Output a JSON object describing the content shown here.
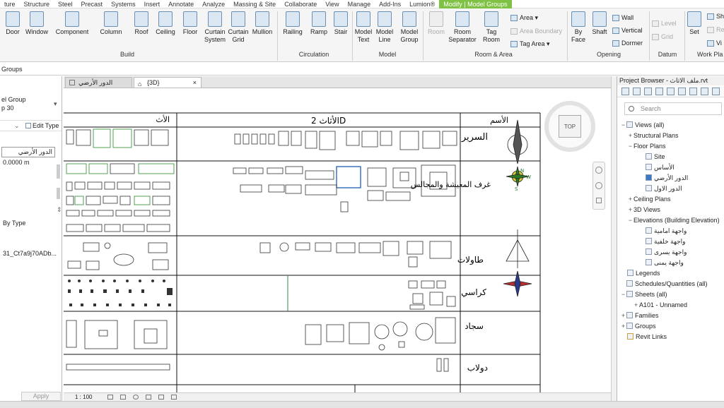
{
  "ribbon_tabs": [
    {
      "label": "ture"
    },
    {
      "label": "Structure"
    },
    {
      "label": "Steel"
    },
    {
      "label": "Precast"
    },
    {
      "label": "Systems"
    },
    {
      "label": "Insert"
    },
    {
      "label": "Annotate"
    },
    {
      "label": "Analyze"
    },
    {
      "label": "Massing & Site"
    },
    {
      "label": "Collaborate"
    },
    {
      "label": "View"
    },
    {
      "label": "Manage"
    },
    {
      "label": "Add-Ins"
    },
    {
      "label": "Lumion®"
    },
    {
      "label": "Modify | Model Groups"
    }
  ],
  "ribbon": {
    "build": {
      "door": "Door",
      "window": "Window",
      "component": "Component",
      "column": "Column",
      "roof": "Roof",
      "ceiling": "Ceiling",
      "floor": "Floor",
      "curtain_system_1": "Curtain",
      "curtain_system_2": "System",
      "curtain_grid_1": "Curtain",
      "curtain_grid_2": "Grid",
      "mullion": "Mullion",
      "group": "Build"
    },
    "circulation": {
      "railing": "Railing",
      "ramp": "Ramp",
      "stair": "Stair",
      "group": "Circulation"
    },
    "model": {
      "text_1": "Model",
      "text_2": "Text",
      "line_1": "Model",
      "line_2": "Line",
      "group_1": "Model",
      "group_2": "Group",
      "group": "Model"
    },
    "room": {
      "room": "Room",
      "sep_1": "Room",
      "sep_2": "Separator",
      "tag_1": "Tag",
      "tag_2": "Room",
      "area": "Area",
      "area_boundary": "Area  Boundary",
      "tag_area": "Tag  Area",
      "group": "Room & Area"
    },
    "opening": {
      "byface_1": "By",
      "byface_2": "Face",
      "shaft": "Shaft",
      "wall": "Wall",
      "vertical": "Vertical",
      "dormer": "Dormer",
      "group": "Opening"
    },
    "datum": {
      "level": "Level",
      "grid": "Grid",
      "group": "Datum"
    },
    "workplane": {
      "set": "Set",
      "sh": "Sh",
      "re": "Re",
      "vi": "Vi",
      "group": "Work Pla"
    }
  },
  "context_label": "Groups",
  "properties": {
    "type_line1": "el Group",
    "type_line2": "p 30",
    "edit_type": "Edit Type",
    "level_value": "الدور الأرضي",
    "offset_value": "0.0000 m",
    "by_type": "By Type",
    "guid_value": "31_Ct7a9j70ADb...",
    "apply": "Apply"
  },
  "view_tabs": [
    {
      "label": "الدور الأرضي"
    },
    {
      "label": "{3D}"
    }
  ],
  "drawing": {
    "header_name": "الأسم",
    "header_2d": "الأثاث 2D",
    "header_3d": "الأث",
    "rows": [
      {
        "label": "السرير"
      },
      {
        "label": "غرف المعيشة والمجالس"
      },
      {
        "label": "طاولات"
      },
      {
        "label": "كراسي"
      },
      {
        "label": "سجاد"
      },
      {
        "label": "دولاب"
      }
    ]
  },
  "viewcube": {
    "face": "TOP"
  },
  "status": {
    "scale": "1 : 100"
  },
  "project_browser": {
    "title": "Project Browser - ملف الاثاث.rvt",
    "search_placeholder": "Search",
    "views_all": "Views (all)",
    "structural_plans": "Structural Plans",
    "floor_plans": "Floor Plans",
    "fp_site": "Site",
    "fp_foundation": "الأساس",
    "fp_ground": "الدور الأرضي",
    "fp_first": "الدور الاول",
    "ceiling_plans": "Ceiling Plans",
    "views_3d": "3D Views",
    "elevations": "Elevations (Building Elevation)",
    "elev_front": "واجهة امامية",
    "elev_back": "واجهة خلفية",
    "elev_left": "واجهة يسرى",
    "elev_right": "واجهة يمنى",
    "legends": "Legends",
    "schedules": "Schedules/Quantities (all)",
    "sheets": "Sheets (all)",
    "sheet_a101": "A101 - Unnamed",
    "families": "Families",
    "groups": "Groups",
    "revit_links": "Revit Links"
  }
}
